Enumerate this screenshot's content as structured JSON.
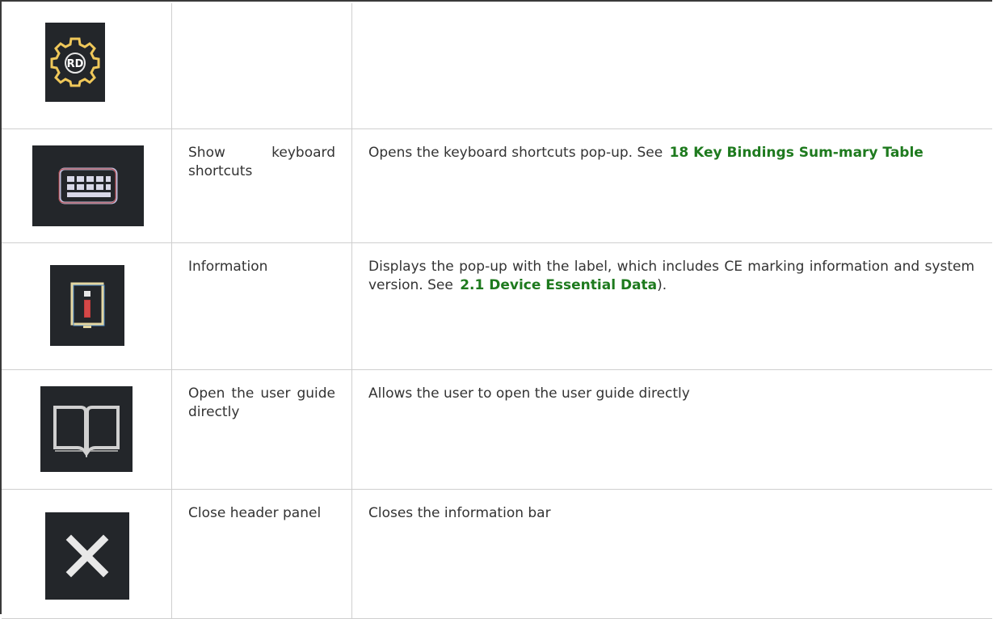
{
  "rows": [
    {
      "icon": "settings-gear-rd-icon",
      "name": "",
      "description": []
    },
    {
      "icon": "keyboard-icon",
      "name": "Show keyboard shortcuts",
      "description": [
        {
          "text": "Opens the keyboard shortcuts pop-up. See"
        },
        {
          "link": "18 Key Bindings Sum-mary Table"
        }
      ]
    },
    {
      "icon": "information-icon",
      "name": "Information",
      "description": [
        {
          "text": "Displays the pop-up with the label, which includes CE marking information and system version. See"
        },
        {
          "link": "2.1 Device Essential Data"
        },
        {
          "text": ")."
        }
      ]
    },
    {
      "icon": "book-icon",
      "name": "Open the user guide directly",
      "description": [
        {
          "text": "Allows the user to open the user guide directly"
        }
      ]
    },
    {
      "icon": "close-icon",
      "name": "Close header panel",
      "description": [
        {
          "text": "Closes the information bar"
        }
      ]
    }
  ],
  "gear_label": "RD",
  "colors": {
    "link": "#1e7a1e",
    "icon_bg": "#23262a"
  }
}
